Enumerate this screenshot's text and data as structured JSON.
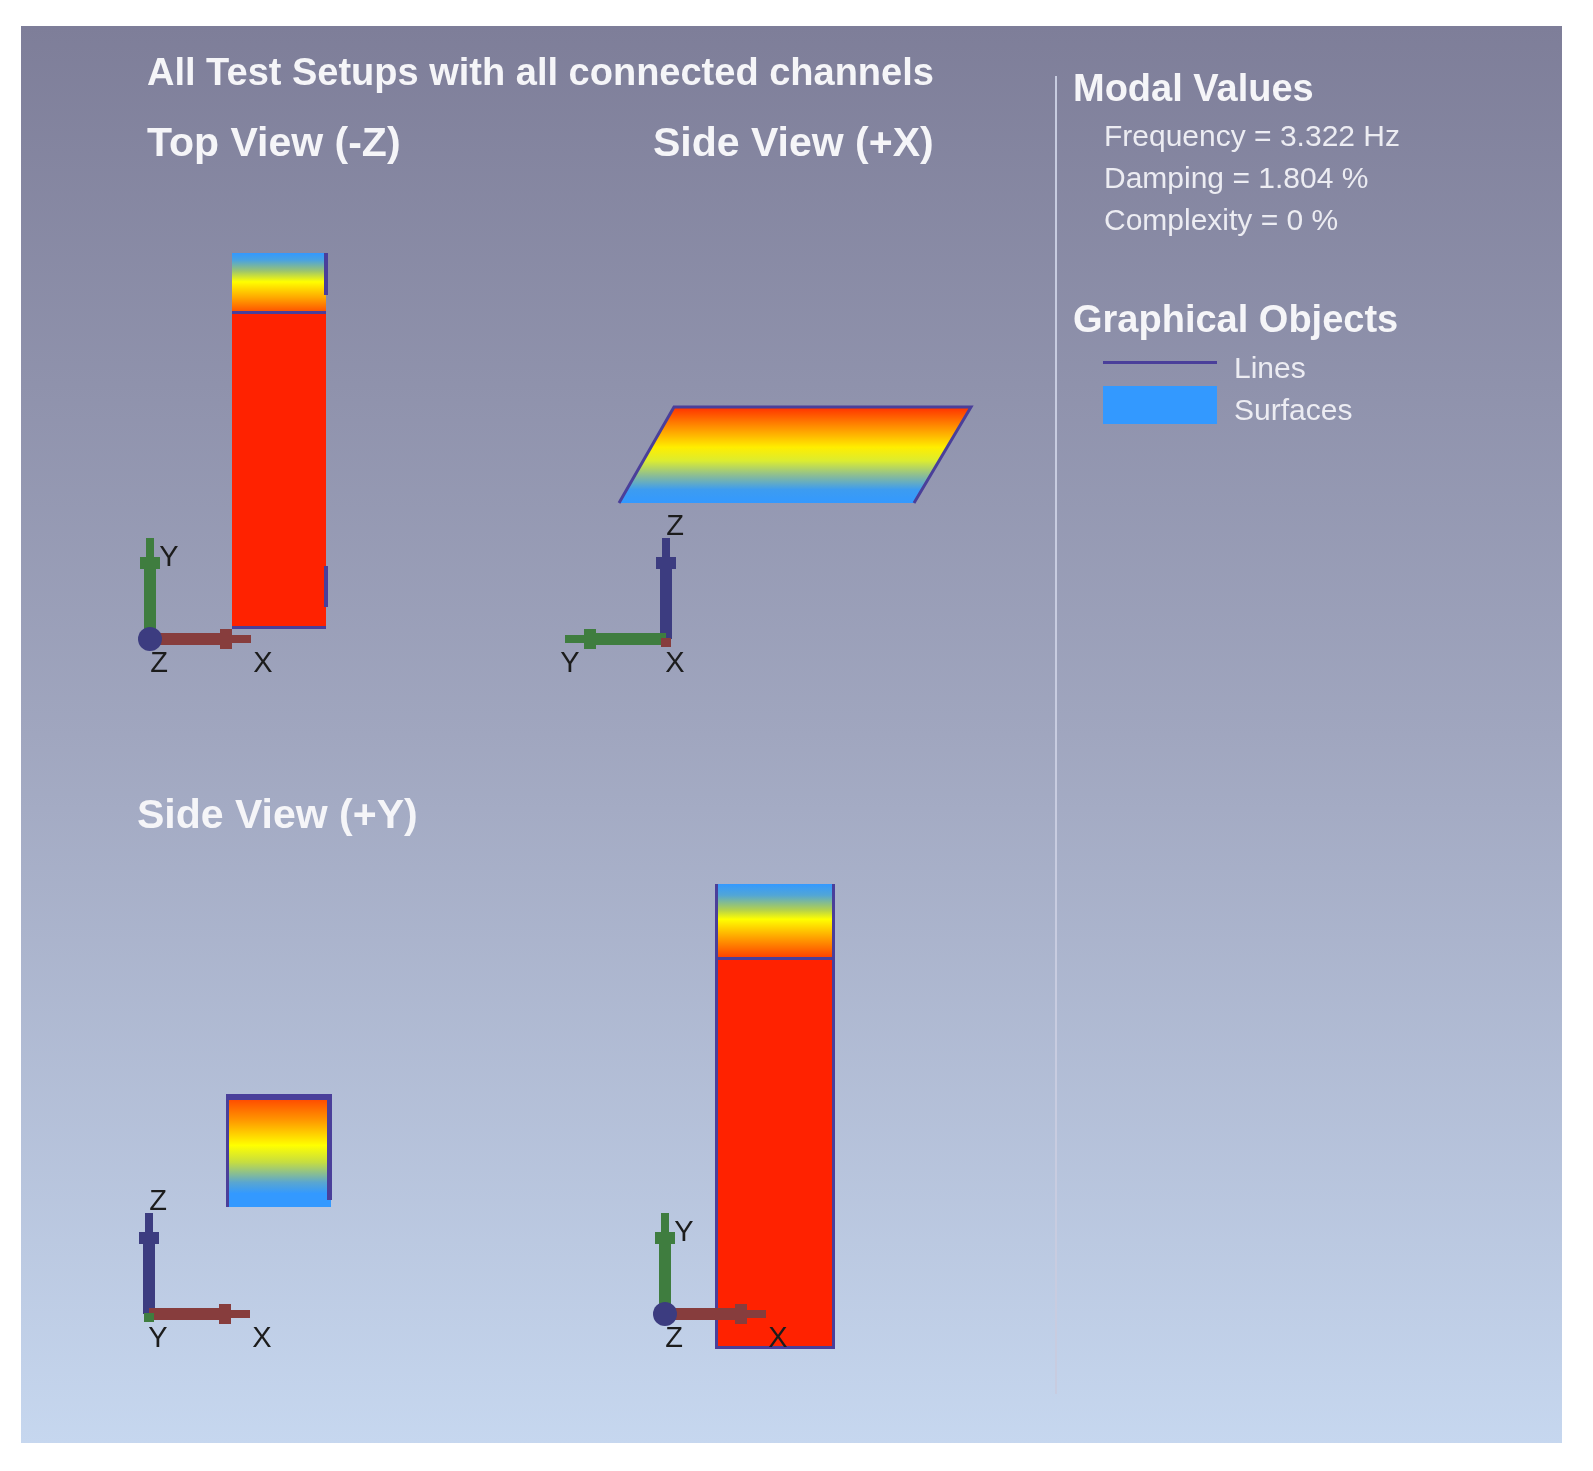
{
  "title": "All Test Setups with all connected channels",
  "views": [
    {
      "kind": "column",
      "title": "Top View (-Z)",
      "axes": [
        {
          "label": "Y",
          "kind": "up",
          "color": "#3f7d3f"
        },
        {
          "label": "X",
          "kind": "right",
          "color": "#873d3d"
        },
        {
          "label": "Z",
          "kind": "toward",
          "color": "#3c3c80"
        }
      ]
    },
    {
      "kind": "slab",
      "title": "Side View (+X)",
      "axes": [
        {
          "label": "Z",
          "kind": "up",
          "color": "#3c3c80"
        },
        {
          "label": "Y",
          "kind": "left",
          "color": "#3f7d3f"
        },
        {
          "label": "X",
          "kind": "away",
          "color": "#873d3d"
        }
      ]
    },
    {
      "kind": "block",
      "title": "Side View (+Y)",
      "axes": [
        {
          "label": "Z",
          "kind": "up",
          "color": "#3c3c80"
        },
        {
          "label": "X",
          "kind": "right",
          "color": "#873d3d"
        },
        {
          "label": "Y",
          "kind": "away",
          "color": "#3f7d3f"
        }
      ]
    },
    {
      "kind": "tower",
      "axes": [
        {
          "label": "Y",
          "kind": "up",
          "color": "#3f7d3f"
        },
        {
          "label": "X",
          "kind": "right",
          "color": "#873d3d"
        },
        {
          "label": "Z",
          "kind": "toward",
          "color": "#3c3c80"
        }
      ]
    }
  ],
  "modal_values": {
    "title": "Modal Values",
    "items": [
      "Frequency = 3.322 Hz",
      "Damping = 1.804 %",
      "Complexity = 0 %"
    ]
  },
  "graphical_objects": {
    "title": "Graphical Objects",
    "items": [
      {
        "kind": "line",
        "label": "Lines",
        "color": "#4a3f9a"
      },
      {
        "kind": "surface",
        "label": "Surfaces",
        "color": "#3399ff"
      }
    ]
  }
}
